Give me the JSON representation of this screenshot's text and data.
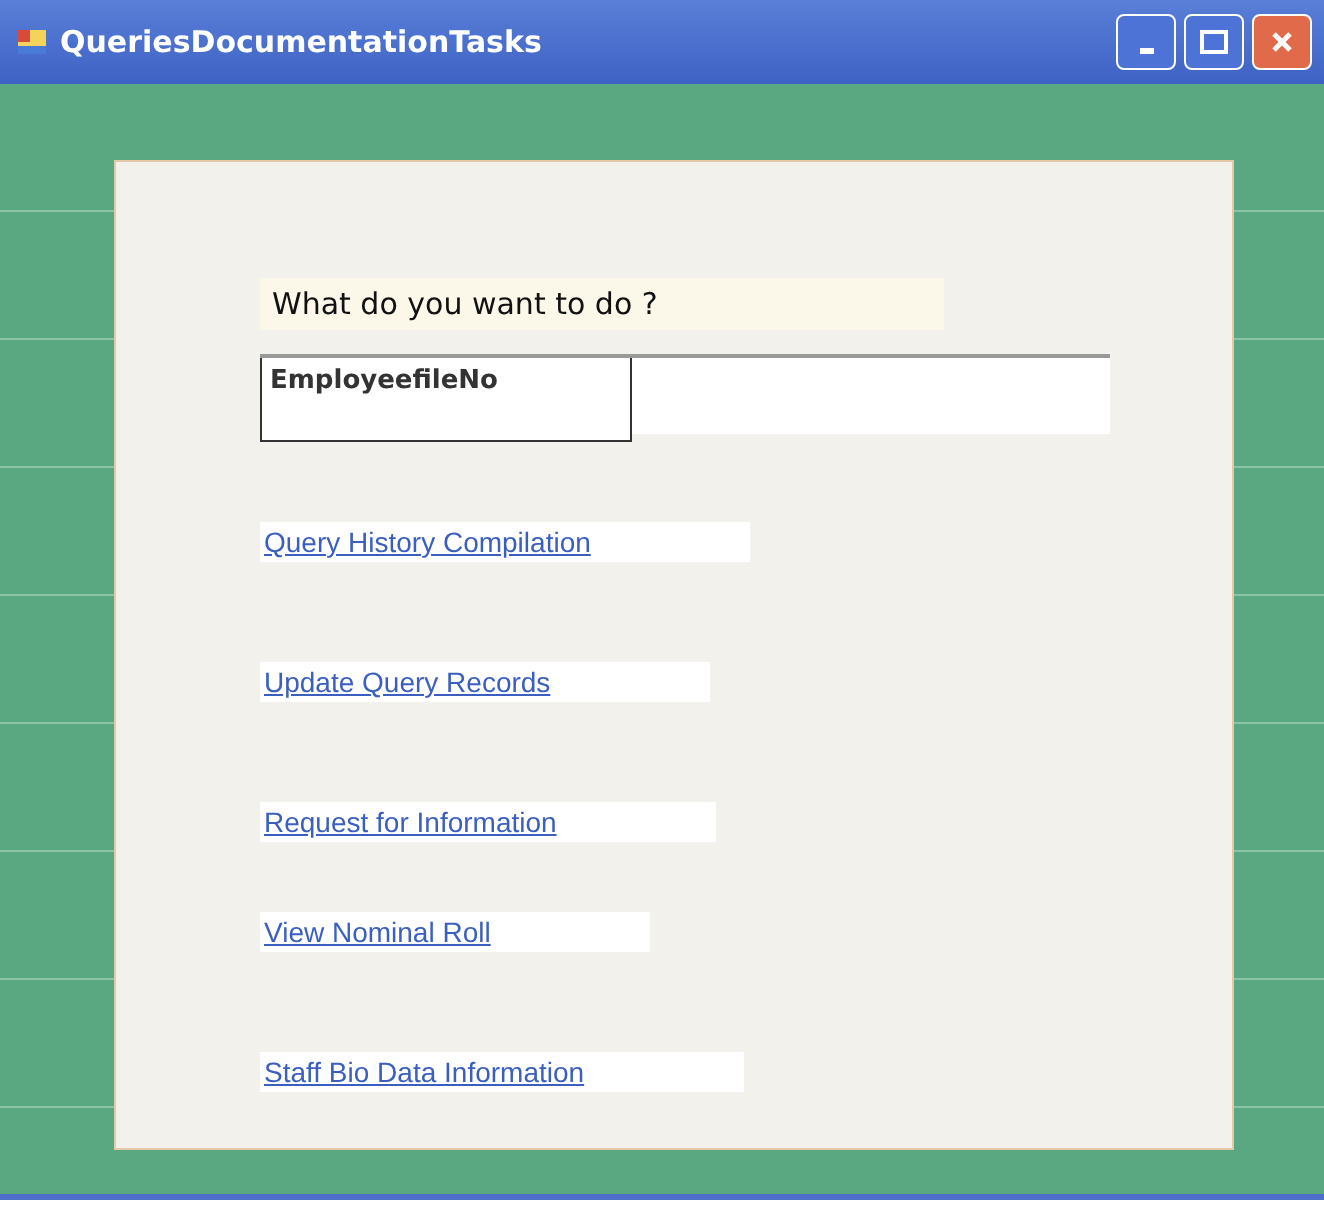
{
  "window": {
    "title": "QueriesDocumentationTasks"
  },
  "prompt": "What do you want to do ?",
  "employee_field": {
    "label": "EmployeefileNo"
  },
  "links": [
    {
      "label": "Query History Compilation"
    },
    {
      "label": "Update Query Records"
    },
    {
      "label": "Request for Information"
    },
    {
      "label": "View Nominal Roll"
    },
    {
      "label": "Staff Bio Data Information"
    }
  ]
}
